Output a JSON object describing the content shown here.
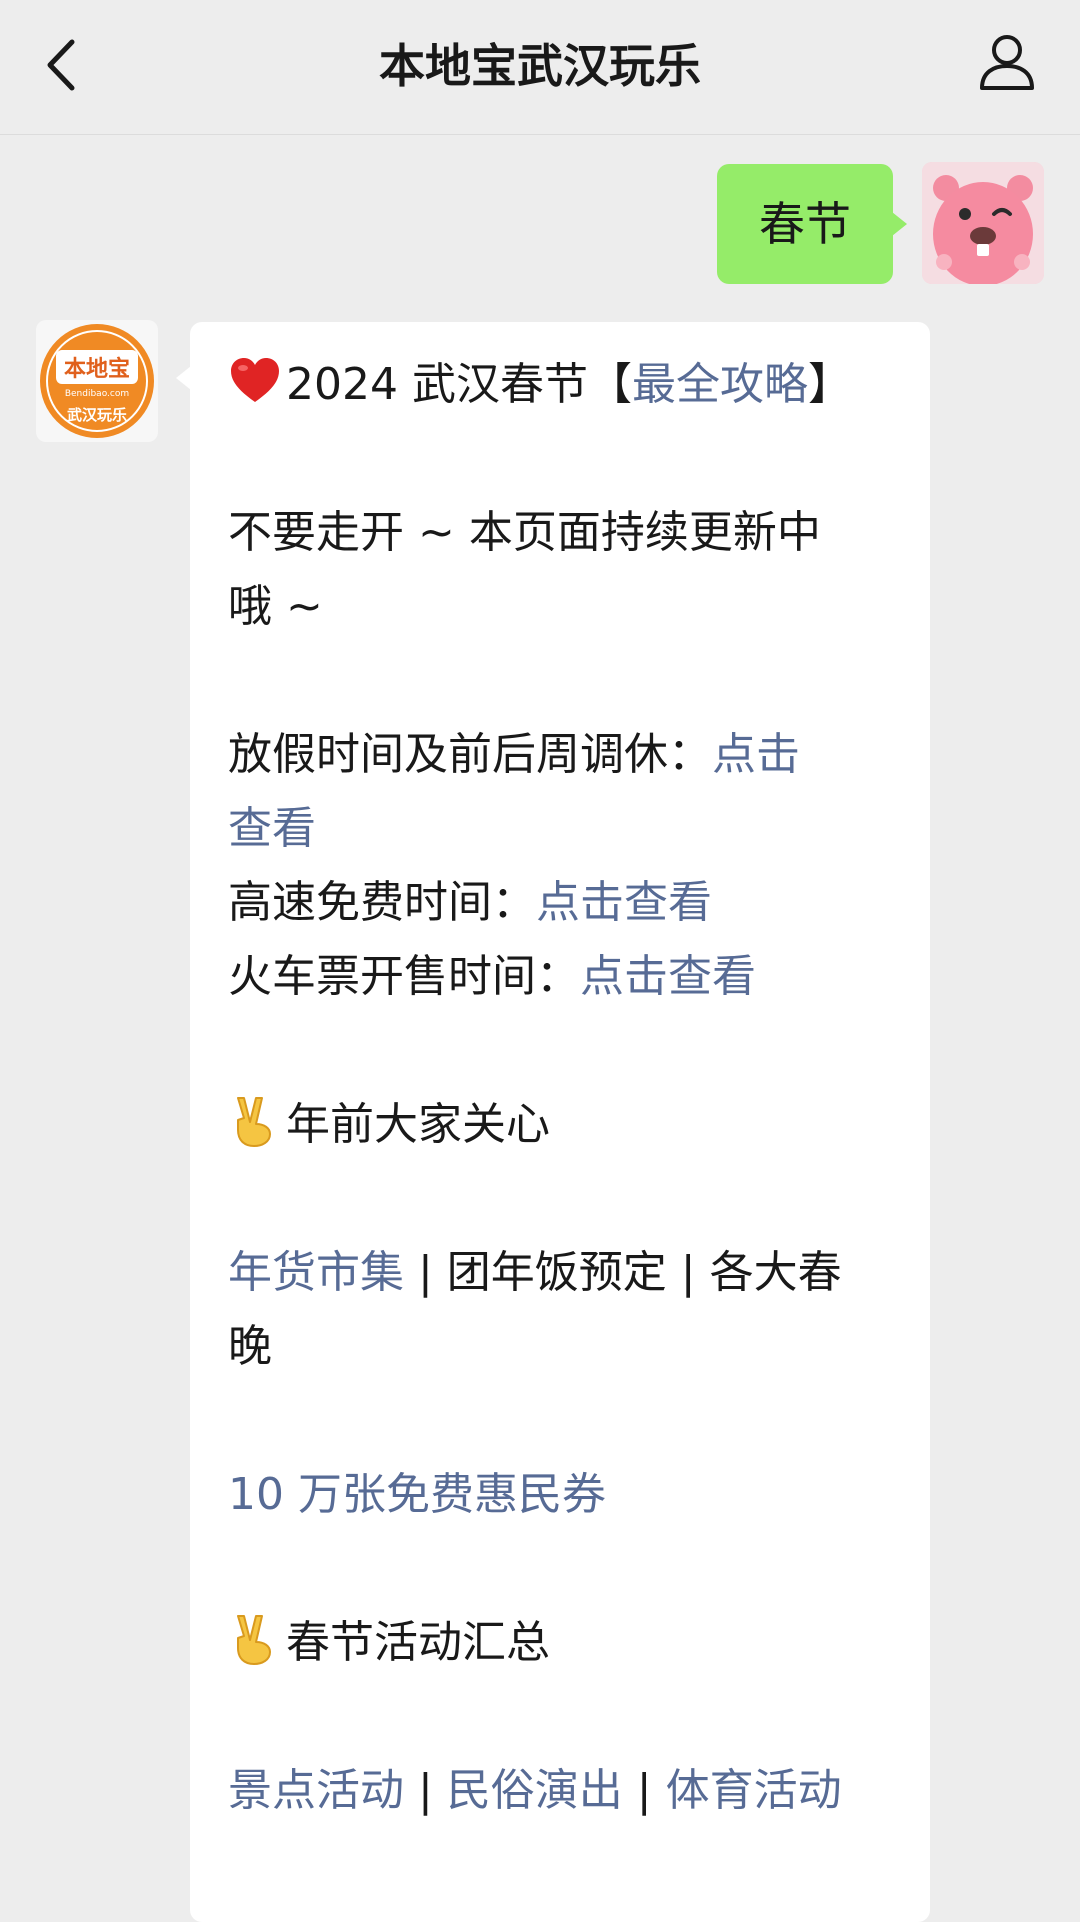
{
  "header": {
    "title": "本地宝武汉玩乐",
    "back_icon": "chevron-left-icon",
    "profile_icon": "person-icon"
  },
  "user_message": {
    "text": "春节",
    "bubble_color": "#95ec69"
  },
  "official_account": {
    "logo_text": "本地宝",
    "logo_domain": "Bendibao.com",
    "logo_subtitle": "武汉玩乐",
    "logo_color": "#f08a24"
  },
  "reply": {
    "title_prefix": "2024 武汉春节【",
    "title_link": "最全攻略",
    "title_suffix": "】",
    "stay_notice": "不要走开 ~ 本页面持续更新中",
    "stay_notice_2": "哦 ~",
    "holiday_label": "放假时间及前后周调休：",
    "holiday_link_1": "点击",
    "holiday_link_2": "查看",
    "highway_label": "高速免费时间：",
    "highway_link": "点击查看",
    "train_label": "火车票开售时间：",
    "train_link": "点击查看",
    "section1_title": "年前大家关心",
    "market_link": "年货市集",
    "separator": " | ",
    "reunion_dinner": "团年饭预定",
    "gala_1": "各大春",
    "gala_2": "晚",
    "coupon_link": "10 万张免费惠民券",
    "section2_title": "春节活动汇总",
    "scenic_link": "景点活动",
    "folk_link": "民俗演出",
    "sports_link": "体育活动",
    "link_color": "#576b95"
  }
}
